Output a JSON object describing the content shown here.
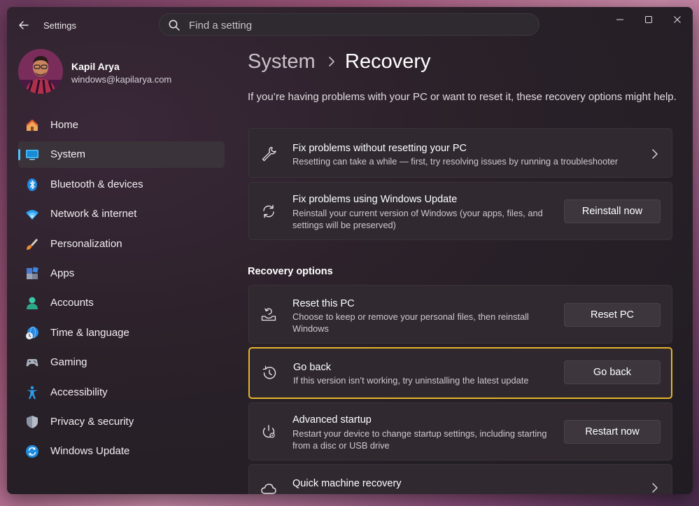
{
  "window": {
    "app_title": "Settings",
    "search_placeholder": "Find a setting"
  },
  "profile": {
    "name": "Kapil Arya",
    "email": "windows@kapilarya.com"
  },
  "nav": {
    "items": [
      {
        "label": "Home",
        "icon": "home-icon"
      },
      {
        "label": "System",
        "icon": "system-icon"
      },
      {
        "label": "Bluetooth & devices",
        "icon": "bluetooth-icon"
      },
      {
        "label": "Network & internet",
        "icon": "network-icon"
      },
      {
        "label": "Personalization",
        "icon": "brush-icon"
      },
      {
        "label": "Apps",
        "icon": "apps-icon"
      },
      {
        "label": "Accounts",
        "icon": "accounts-icon"
      },
      {
        "label": "Time & language",
        "icon": "time-language-icon"
      },
      {
        "label": "Gaming",
        "icon": "gamepad-icon"
      },
      {
        "label": "Accessibility",
        "icon": "accessibility-icon"
      },
      {
        "label": "Privacy & security",
        "icon": "shield-icon"
      },
      {
        "label": "Windows Update",
        "icon": "windows-update-icon"
      }
    ],
    "active_index": 1
  },
  "content": {
    "breadcrumb_parent": "System",
    "breadcrumb_current": "Recovery",
    "intro": "If you’re having problems with your PC or want to reset it, these recovery options might help.",
    "fix_without_reset": {
      "title": "Fix problems without resetting your PC",
      "desc": "Resetting can take a while — first, try resolving issues by running a troubleshooter"
    },
    "fix_windows_update": {
      "title": "Fix problems using Windows Update",
      "desc": "Reinstall your current version of Windows (your apps, files, and settings will be preserved)",
      "button": "Reinstall now"
    },
    "section_title": "Recovery options",
    "reset_pc": {
      "title": "Reset this PC",
      "desc": "Choose to keep or remove your personal files, then reinstall Windows",
      "button": "Reset PC"
    },
    "go_back": {
      "title": "Go back",
      "desc": "If this version isn’t working, try uninstalling the latest update",
      "button": "Go back"
    },
    "advanced_startup": {
      "title": "Advanced startup",
      "desc": "Restart your device to change startup settings, including starting from a disc or USB drive",
      "button": "Restart now"
    },
    "quick_recovery": {
      "title": "Quick machine recovery"
    }
  },
  "colors": {
    "accent": "#4cc2ff",
    "highlight_border": "#e5b52b"
  }
}
